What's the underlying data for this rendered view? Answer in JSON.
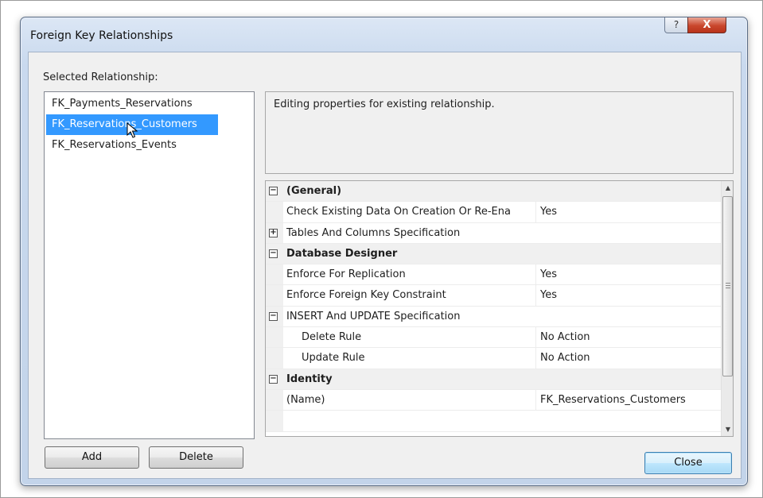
{
  "window": {
    "title": "Foreign Key Relationships",
    "help_glyph": "?",
    "close_glyph": "X"
  },
  "selected_relationship_label": "Selected Relationship:",
  "relationships": [
    {
      "label": "FK_Payments_Reservations",
      "selected": false
    },
    {
      "label": "FK_Reservations_Customers",
      "selected": true
    },
    {
      "label": "FK_Reservations_Events",
      "selected": false
    }
  ],
  "description": "Editing properties for existing relationship.",
  "property_grid": {
    "rows": [
      {
        "type": "category",
        "toggle": "−",
        "name": "(General)",
        "value": ""
      },
      {
        "type": "property",
        "toggle": "",
        "name": "Check Existing Data On Creation Or Re-Ena",
        "value": "Yes"
      },
      {
        "type": "property",
        "toggle": "+",
        "name": "Tables And Columns Specification",
        "value": ""
      },
      {
        "type": "category",
        "toggle": "−",
        "name": "Database Designer",
        "value": ""
      },
      {
        "type": "property",
        "toggle": "",
        "name": "Enforce For Replication",
        "value": "Yes"
      },
      {
        "type": "property",
        "toggle": "",
        "name": "Enforce Foreign Key Constraint",
        "value": "Yes"
      },
      {
        "type": "property",
        "toggle": "−",
        "name": "INSERT And UPDATE Specification",
        "value": ""
      },
      {
        "type": "subproperty",
        "toggle": "",
        "name": "Delete Rule",
        "value": "No Action"
      },
      {
        "type": "subproperty",
        "toggle": "",
        "name": "Update Rule",
        "value": "No Action"
      },
      {
        "type": "category",
        "toggle": "−",
        "name": "Identity",
        "value": ""
      },
      {
        "type": "property",
        "toggle": "",
        "name": "(Name)",
        "value": "FK_Reservations_Customers"
      },
      {
        "type": "property",
        "toggle": "",
        "name": "",
        "value": ""
      }
    ],
    "scroll_up": "▲",
    "scroll_down": "▼"
  },
  "buttons": {
    "add": "Add",
    "delete": "Delete",
    "close": "Close"
  },
  "colors": {
    "selection": "#3399ff",
    "close_button_accent": "#c9462c"
  },
  "icons": {
    "help": "help-icon",
    "close": "close-icon",
    "cursor": "mouse-pointer-icon"
  }
}
